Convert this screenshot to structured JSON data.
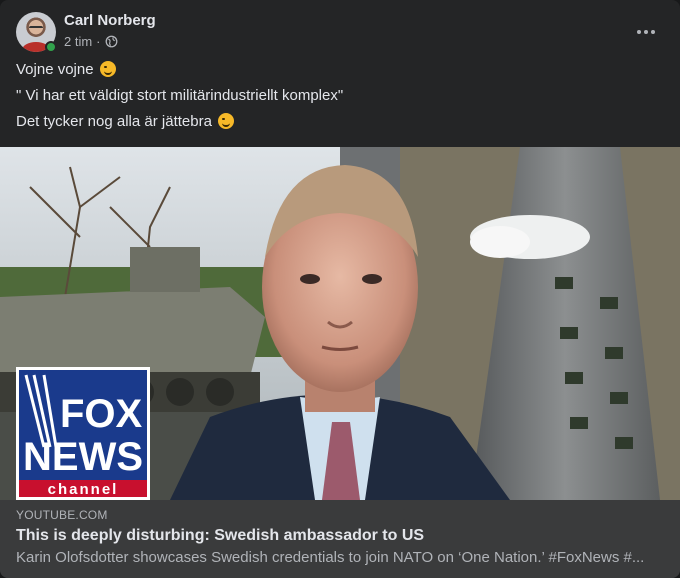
{
  "post": {
    "author": "Carl Norberg",
    "time": "2 tim",
    "separator": "·",
    "privacy_icon": "globe-icon",
    "menu_icon": "more-options-icon",
    "lines": [
      "Vojne vojne",
      "\" Vi har ett väldigt stort militärindustriellt komplex\"",
      "Det tycker nog alla är jättebra"
    ],
    "emoji_icon": "smirk-emoji-icon"
  },
  "media": {
    "logo_line1": "FOX",
    "logo_line2": "NEWS",
    "logo_line3": "channel"
  },
  "link_preview": {
    "domain": "YOUTUBE.COM",
    "title": "This is deeply disturbing: Swedish ambassador to US",
    "description": "Karin Olofsdotter showcases Swedish credentials to join NATO on ‘One Nation.’ #FoxNews #..."
  },
  "colors": {
    "card": "#242526",
    "link_bg": "#3a3b3c",
    "online": "#31a24c",
    "fox_blue": "#1a3a8c",
    "fox_red": "#c8102e"
  }
}
